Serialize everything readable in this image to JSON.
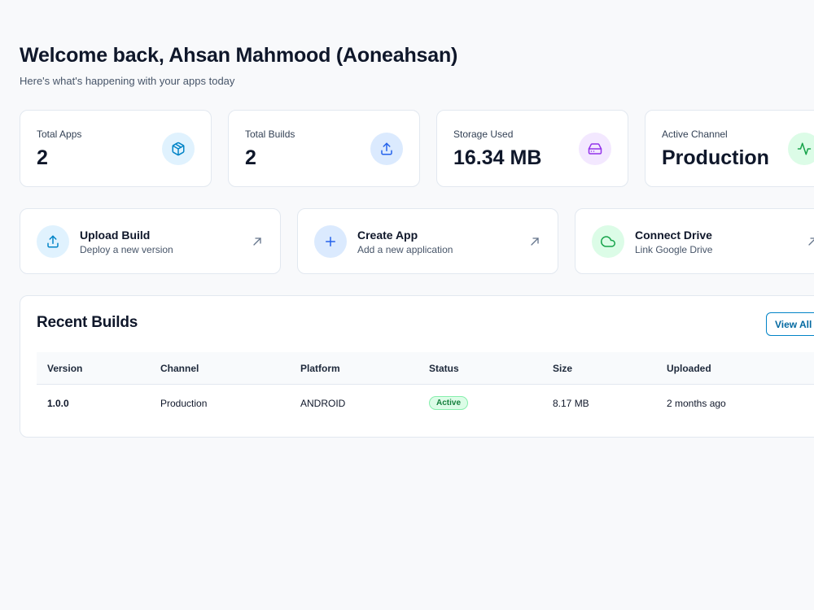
{
  "header": {
    "title": "Welcome back, Ahsan Mahmood (Aoneahsan)",
    "subtitle": "Here's what's happening with your apps today"
  },
  "stats": [
    {
      "label": "Total Apps",
      "value": "2",
      "icon": "package-icon",
      "color": "#0284c7",
      "bg": "#e0f2fe"
    },
    {
      "label": "Total Builds",
      "value": "2",
      "icon": "upload-icon",
      "color": "#2563eb",
      "bg": "#dbeafe"
    },
    {
      "label": "Storage Used",
      "value": "16.34 MB",
      "icon": "hard-drive-icon",
      "color": "#9333ea",
      "bg": "#f3e8ff"
    },
    {
      "label": "Active Channel",
      "value": "Production",
      "icon": "activity-icon",
      "color": "#16a34a",
      "bg": "#dcfce7"
    }
  ],
  "actions": [
    {
      "title": "Upload Build",
      "desc": "Deploy a new version",
      "icon": "upload-icon",
      "color": "#0284c7",
      "bg": "#e0f2fe"
    },
    {
      "title": "Create App",
      "desc": "Add a new application",
      "icon": "plus-icon",
      "color": "#2563eb",
      "bg": "#dbeafe"
    },
    {
      "title": "Connect Drive",
      "desc": "Link Google Drive",
      "icon": "cloud-icon",
      "color": "#16a34a",
      "bg": "#dcfce7"
    }
  ],
  "recent_builds": {
    "title": "Recent Builds",
    "view_all_label": "View All",
    "columns": [
      "Version",
      "Channel",
      "Platform",
      "Status",
      "Size",
      "Uploaded"
    ],
    "rows": [
      {
        "version": "1.0.0",
        "channel": "Production",
        "platform": "ANDROID",
        "status": "Active",
        "size": "8.17 MB",
        "uploaded": "2 months ago"
      }
    ]
  }
}
